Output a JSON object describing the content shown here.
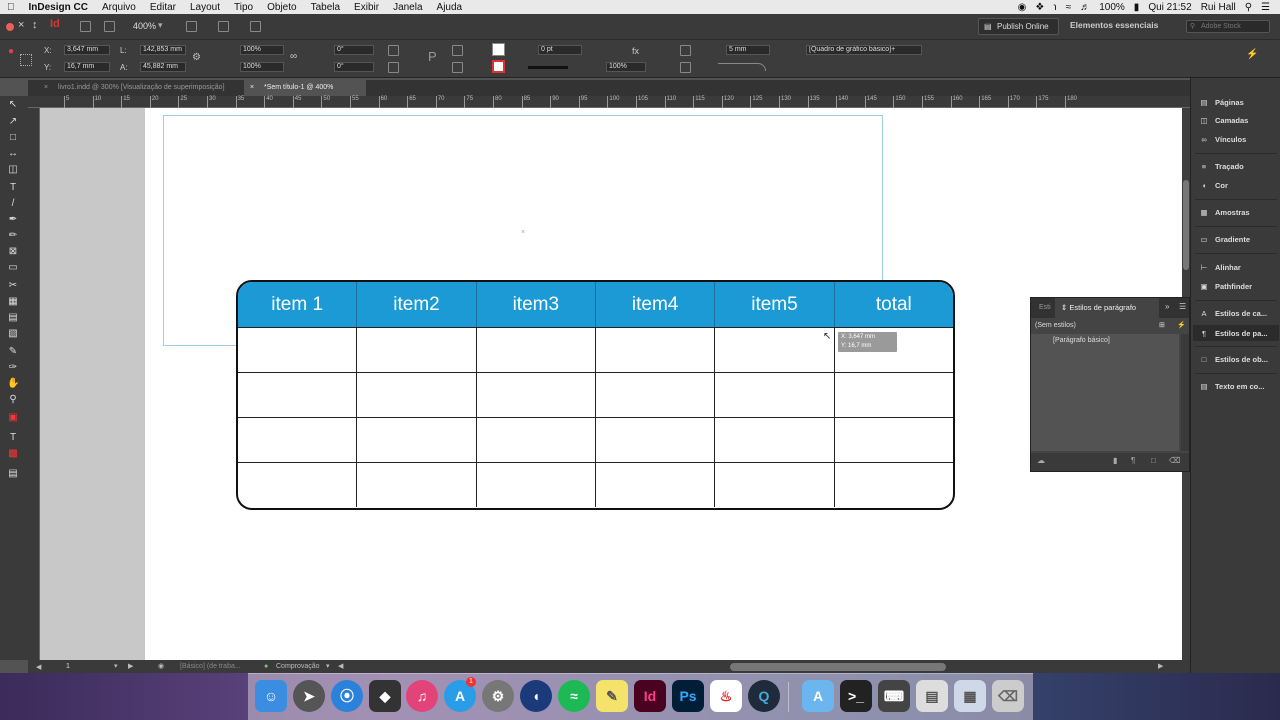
{
  "menubar": {
    "app": "InDesign CC",
    "items": [
      "Arquivo",
      "Editar",
      "Layout",
      "Tipo",
      "Objeto",
      "Tabela",
      "Exibir",
      "Janela",
      "Ajuda"
    ],
    "battery": "100%",
    "time": "Qui 21:52",
    "user": "Rui Hall"
  },
  "appbar": {
    "zoom": "400%",
    "publish": "Publish Online",
    "workspace": "Elementos essenciais",
    "search_placeholder": "Adobe Stock"
  },
  "control": {
    "x_label": "X:",
    "x": "3,647 mm",
    "y_label": "Y:",
    "y": "16,7 mm",
    "l_label": "L:",
    "l": "142,853 mm",
    "a_label": "A:",
    "a": "45,882 mm",
    "scale1": "100%",
    "scale2": "100%",
    "angle1": "0°",
    "angle2": "0°",
    "stroke": "0 pt",
    "opacity": "100%",
    "spacing": "5 mm",
    "frame_style": "[Quadro de gráfico básico]+"
  },
  "tabs": [
    {
      "label": "livro1.indd @ 300% [Visualização de superimposição]"
    },
    {
      "label": "*Sem título-1 @ 400%"
    }
  ],
  "ruler_marks": [
    "5",
    "10",
    "15",
    "20",
    "25",
    "30",
    "35",
    "40",
    "45",
    "50",
    "55",
    "60",
    "65",
    "70",
    "75",
    "80",
    "85",
    "90",
    "95",
    "100",
    "105",
    "110",
    "115",
    "120",
    "125",
    "130",
    "135",
    "140",
    "145",
    "150",
    "155",
    "160",
    "165",
    "170",
    "175",
    "180"
  ],
  "table": {
    "headers": [
      "item 1",
      "item2",
      "item3",
      "item4",
      "item5",
      "total"
    ],
    "rows": 4,
    "header_color": "#1b9ad6"
  },
  "tooltip": {
    "x": "X: 3,647 mm",
    "y": "Y: 16,7 mm"
  },
  "status": {
    "page": "1",
    "style": "[Básico] (de traba...",
    "preflight": "Comprovação"
  },
  "dock_panels": [
    "Páginas",
    "Camadas",
    "Vínculos",
    "Traçado",
    "Cor",
    "Amostras",
    "Gradiente",
    "Alinhar",
    "Pathfinder",
    "Estilos de ca...",
    "Estilos de pa...",
    "Estilos de ob...",
    "Texto em co..."
  ],
  "para_panel": {
    "tab_short": "Esti",
    "tab": "Estilos de parágrafo",
    "current": "(Sem estilos)",
    "item": "[Parágrafo básico]"
  },
  "dock_apps": [
    "Finder",
    "Launchpad",
    "Safari",
    "Unity",
    "iTunes",
    "App Store",
    "System Preferences",
    "Cinema 4D",
    "Spotify",
    "Stickies",
    "InDesign",
    "Photoshop",
    "Acrobat",
    "QuickTime",
    "Applications",
    "Terminal",
    "Keyboard",
    "Documents",
    "Preview",
    "Trash"
  ],
  "dock_badge": "1"
}
